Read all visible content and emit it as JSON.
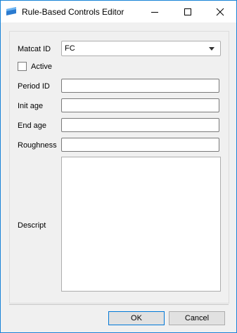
{
  "window": {
    "title": "Rule-Based Controls Editor"
  },
  "form": {
    "matcat_label": "Matcat ID",
    "matcat_value": "FC",
    "active_label": "Active",
    "active_checked": false,
    "period_label": "Period ID",
    "period_value": "",
    "init_age_label": "Init age",
    "init_age_value": "",
    "end_age_label": "End age",
    "end_age_value": "",
    "roughness_label": "Roughness",
    "roughness_value": "",
    "descript_label": "Descript",
    "descript_value": ""
  },
  "buttons": {
    "ok_label": "OK",
    "cancel_label": "Cancel"
  },
  "colors": {
    "accent": "#0078d7",
    "window_bg": "#f0f0f0"
  }
}
